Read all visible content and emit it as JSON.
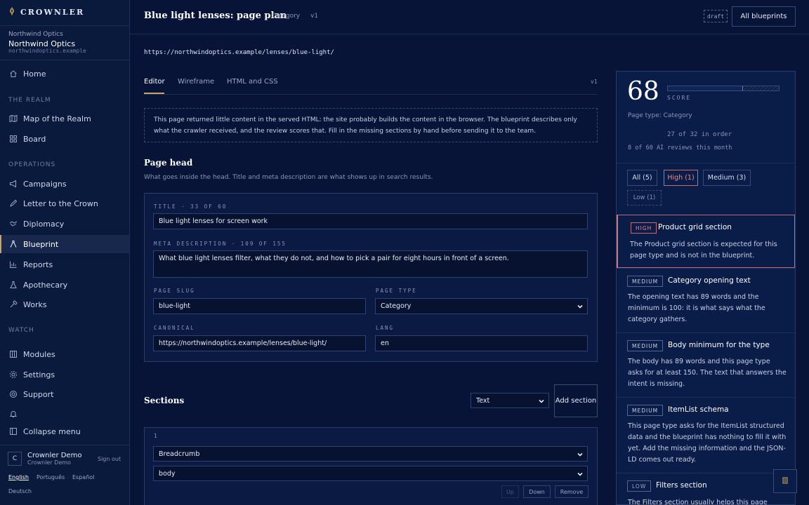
{
  "brand": {
    "name": "CROWNLER"
  },
  "org": {
    "label": "Northwind Optics",
    "name": "Northwind Optics",
    "domain": "northwindoptics.example"
  },
  "nav": {
    "home": "Home",
    "section_realm": "THE REALM",
    "map": "Map of the Realm",
    "board": "Board",
    "section_operations": "OPERATIONS",
    "campaigns": "Campaigns",
    "letter": "Letter to the Crown",
    "diplomacy": "Diplomacy",
    "blueprint": "Blueprint",
    "reports": "Reports",
    "apothecary": "Apothecary",
    "works": "Works",
    "section_watch": "WATCH",
    "modules": "Modules",
    "settings": "Settings",
    "support": "Support",
    "collapse": "Collapse menu"
  },
  "user": {
    "initial": "C",
    "name": "Crownler Demo",
    "sub": "Crownler Demo",
    "sign_out": "Sign out"
  },
  "languages": [
    "English",
    "Português",
    "Español",
    "Deutsch"
  ],
  "header": {
    "title": "Blue light lenses: page plan",
    "type": "Category",
    "version": "v1",
    "draft": "draft",
    "all_blueprints": "All blueprints"
  },
  "url": "https://northwindoptics.example/lenses/blue-light/",
  "tabs": {
    "editor": "Editor",
    "wireframe": "Wireframe",
    "html": "HTML and CSS",
    "version": "v1"
  },
  "notice": "This page returned little content in the served HTML: the site probably builds the content in the browser. The blueprint describes only what the crawler received, and the review scores that. Fill in the missing sections by hand before sending it to the team.",
  "page_head": {
    "title": "Page head",
    "subtitle": "What goes inside the head. Title and meta description are what shows up in search results.",
    "title_label": "TITLE · 33 OF 60",
    "title_value": "Blue light lenses for screen work",
    "meta_label": "META DESCRIPTION · 109 OF 155",
    "meta_value": "What blue light lenses filter, what they do not, and how to pick a pair for eight hours in front of a screen.",
    "slug_label": "PAGE SLUG",
    "slug_value": "blue-light",
    "type_label": "PAGE TYPE",
    "type_value": "Category",
    "canonical_label": "CANONICAL",
    "canonical_value": "https://northwindoptics.example/lenses/blue-light/",
    "lang_label": "LANG",
    "lang_value": "en"
  },
  "sections": {
    "title": "Sections",
    "type_select": "Text",
    "add_button": "Add section",
    "item": {
      "index": "1",
      "kind": "Breadcrumb",
      "placement": "body",
      "up": "Up",
      "down": "Down",
      "remove": "Remove"
    }
  },
  "panel": {
    "score": "68",
    "score_fraction": 0.68,
    "score_label": "SCORE",
    "page_type": "Page type: Category",
    "order": "27 of 32 in order",
    "reviews": "8 of 60 AI reviews this month",
    "filters": {
      "all": "All (5)",
      "high": "High (1)",
      "medium": "Medium (3)",
      "low": "Low (1)"
    },
    "issues": [
      {
        "level": "HIGH",
        "title": "Product grid section",
        "desc": "The Product grid section is expected for this page type and is not in the blueprint."
      },
      {
        "level": "MEDIUM",
        "title": "Category opening text",
        "desc": "The opening text has 89 words and the minimum is 100: it is what says what the category gathers."
      },
      {
        "level": "MEDIUM",
        "title": "Body minimum for the type",
        "desc": "The body has 89 words and this page type asks for at least 150. The text that answers the intent is missing."
      },
      {
        "level": "MEDIUM",
        "title": "ItemList schema",
        "desc": "This page type asks for the ItemList structured data and the blueprint has nothing to fill it with yet. Add the missing information and the JSON-LD comes out ready."
      },
      {
        "level": "LOW",
        "title": "Filters section",
        "desc": "The Filters section usually helps this page"
      }
    ]
  },
  "colors": {
    "accent": "#c7a760",
    "background": "#071437",
    "high": "#e88a8a"
  }
}
